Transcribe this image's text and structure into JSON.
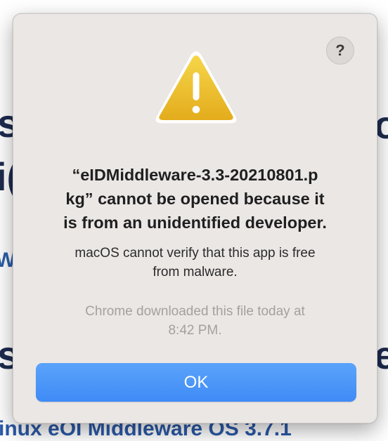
{
  "background": {
    "left_fragments": [
      "s",
      "i(",
      "W",
      "s"
    ],
    "right_fragments": [
      "o",
      "e"
    ],
    "bottom_text": "inux eOI Middleware OS 3.7.1"
  },
  "dialog": {
    "help_label": "?",
    "icon": "warning-triangle-icon",
    "title_lines": [
      "“eIDMiddleware-3.3-20210801.p",
      "kg” cannot be opened because it",
      "is from an unidentified developer."
    ],
    "message_lines": [
      "macOS cannot verify that this app is free",
      "from malware."
    ],
    "subtext_lines": [
      "Chrome downloaded this file today at",
      "8:42 PM."
    ],
    "ok_label": "OK"
  },
  "colors": {
    "dialog_bg": "#ebe7e5",
    "ok_button": "#4a94f8",
    "warning_yellow": "#f0c42a"
  }
}
